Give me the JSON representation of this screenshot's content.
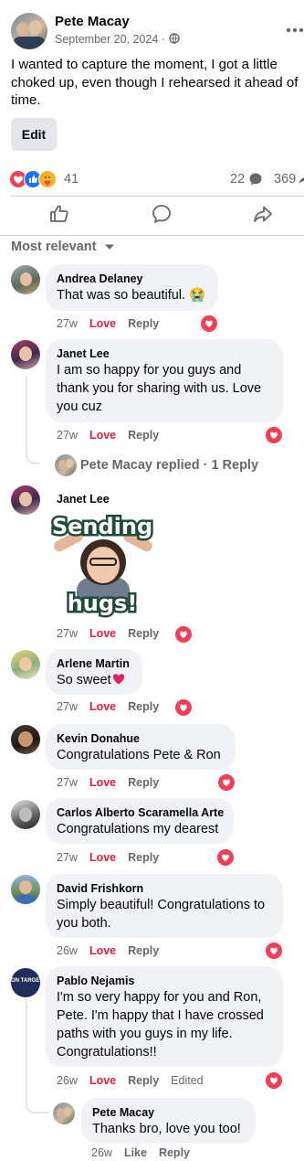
{
  "post": {
    "author": "Pete Macay",
    "date": "September 20, 2024 ·",
    "text": "I wanted to capture the moment, I got a little choked up, even though I rehearsed it ahead of time.",
    "edit_label": "Edit",
    "reaction_count": "41",
    "comment_count": "22",
    "share_count": "369"
  },
  "sort_label": "Most relevant",
  "comments": [
    {
      "name": "Andrea Delaney",
      "text": "That was so beautiful. 😭",
      "time": "27w",
      "love": "Love",
      "reply": "Reply"
    },
    {
      "name": "Janet Lee",
      "text": "I am so happy for you guys and thank you for sharing with us. Love you cuz",
      "time": "27w",
      "love": "Love",
      "reply": "Reply",
      "replies_summary": "Pete Macay replied · 1 Reply"
    },
    {
      "name": "Janet Lee",
      "sticker_line1": "Sending",
      "sticker_line2": "hugs!",
      "time": "27w",
      "love": "Love",
      "reply": "Reply"
    },
    {
      "name": "Arlene Martin",
      "text": "So sweet",
      "time": "27w",
      "love": "Love",
      "reply": "Reply"
    },
    {
      "name": "Kevin Donahue",
      "text": "Congratulations Pete & Ron",
      "time": "27w",
      "love": "Love",
      "reply": "Reply"
    },
    {
      "name": "Carlos Alberto Scaramella Arte",
      "text": "Congratulations my dearest",
      "time": "27w",
      "love": "Love",
      "reply": "Reply"
    },
    {
      "name": "David Frishkorn",
      "text": "Simply beautiful! Congratulations to you both.",
      "time": "26w",
      "love": "Love",
      "reply": "Reply"
    },
    {
      "name": "Pablo Nejamis",
      "text": "I'm so very happy for you and Ron, Pete. I'm happy that I have crossed paths with you guys in my life. Congratulations!!",
      "time": "26w",
      "love": "Love",
      "reply": "Reply",
      "edited": "Edited",
      "avatar_text": "ON TARGET"
    }
  ],
  "reply": {
    "name": "Pete Macay",
    "text": "Thanks bro, love you too!",
    "time": "26w",
    "like": "Like",
    "reply": "Reply"
  },
  "colors": {
    "love": "#e41e3f",
    "like_blue": "#1877f2",
    "bubble": "#f0f2f5",
    "meta": "#65676b"
  },
  "icons": [
    "globe-icon",
    "more-icon",
    "love-reaction-icon",
    "like-reaction-icon",
    "care-reaction-icon",
    "comment-bubble-icon",
    "share-arrow-icon",
    "thumbs-up-icon",
    "chevron-down-icon",
    "heart-icon"
  ]
}
